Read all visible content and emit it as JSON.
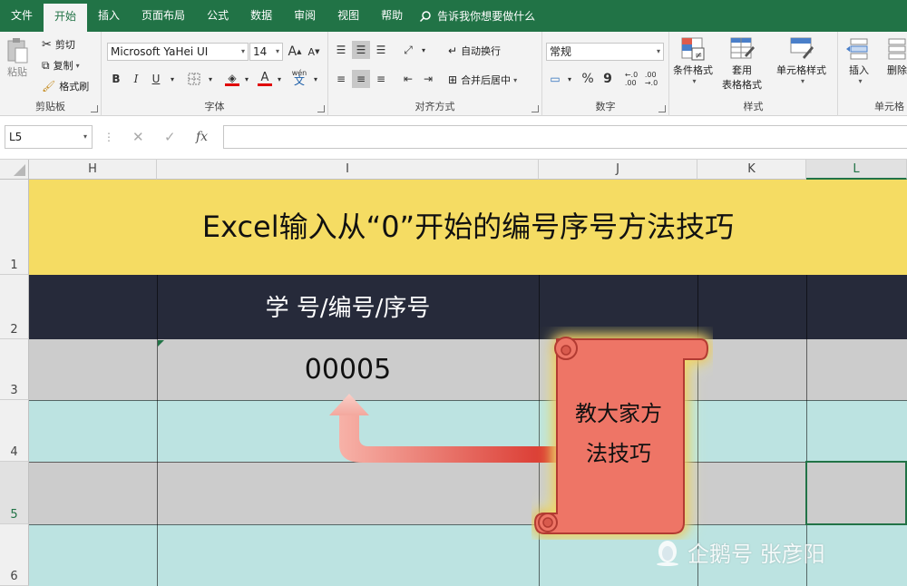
{
  "menu": {
    "tabs": [
      "文件",
      "开始",
      "插入",
      "页面布局",
      "公式",
      "数据",
      "审阅",
      "视图",
      "帮助"
    ],
    "active_tab": "开始",
    "tell_me": "告诉我你想要做什么"
  },
  "ribbon": {
    "clipboard": {
      "paste": "粘贴",
      "cut": "剪切",
      "copy": "复制",
      "format_painter": "格式刷",
      "label": "剪贴板"
    },
    "font": {
      "name": "Microsoft YaHei UI",
      "size": "14",
      "bold": "B",
      "italic": "I",
      "underline": "U",
      "grow": "A",
      "shrink": "A",
      "phonetic": "wén",
      "label": "字体"
    },
    "alignment": {
      "wrap": "自动换行",
      "merge": "合并后居中",
      "label": "对齐方式"
    },
    "number": {
      "format": "常规",
      "percent": "%",
      "comma": "9",
      "label": "数字"
    },
    "styles": {
      "conditional": "条件格式",
      "table_line1": "套用",
      "table_line2": "表格格式",
      "cell_styles": "单元格样式",
      "label": "样式"
    },
    "cells": {
      "insert": "插入",
      "delete": "删除",
      "label": "单元格"
    }
  },
  "formula_bar": {
    "name_box": "L5",
    "fx": "fx",
    "cancel": "✕",
    "enter": "✓",
    "value": ""
  },
  "columns": [
    "H",
    "I",
    "J",
    "K",
    "L"
  ],
  "selected_column": "L",
  "rows": [
    "1",
    "2",
    "3",
    "4",
    "5",
    "6"
  ],
  "selected_row": "5",
  "sheet": {
    "title": "Excel输入从“0”开始的编号序号方法技巧",
    "header": "学 号/编号/序号",
    "value": "00005",
    "callout_line1": "教大家方",
    "callout_line2": "法技巧",
    "watermark": "企鹅号 张彦阳"
  },
  "colors": {
    "excel_green": "#217346",
    "title_bg": "#f5dc63",
    "header_bg": "#262a3a",
    "gray_row": "#cccccc",
    "teal_row": "#bce3e1",
    "scroll_red": "#ee7466",
    "arrow_red": "#e0443a"
  }
}
